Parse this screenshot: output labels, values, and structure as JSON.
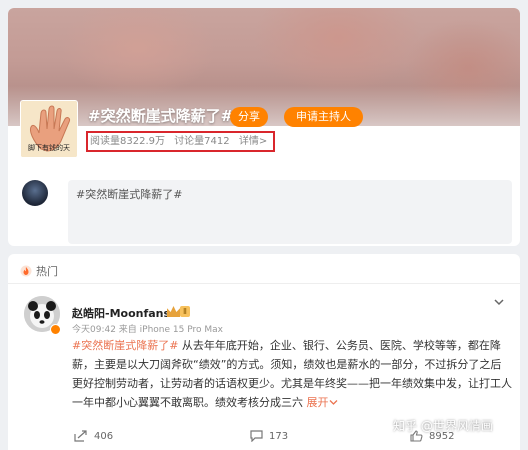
{
  "topic": {
    "title": "#突然断崖式降薪了#",
    "thumb_caption": "脚下有钱的天",
    "share_label": "分享",
    "host_label": "申请主持人",
    "read_count": "阅读量8322.9万",
    "discuss_count": "讨论量7412",
    "detail_link": "详情>"
  },
  "composer": {
    "text": "#突然断崖式降薪了#"
  },
  "hot": {
    "label": "热门"
  },
  "post": {
    "author": "赵皓阳-Moonfans",
    "level_badge": "Ⅱ",
    "meta": "今天09:42  来自 iPhone 15 Pro Max",
    "tag": "#突然断崖式降薪了#",
    "body": " 从去年年底开始，企业、银行、公务员、医院、学校等等，都在降薪，主要是以大刀阔斧砍“绩效”的方式。须知，绩效也是薪水的一部分，不过拆分了之后更好控制劳动者，让劳动者的话语权更少。尤其是年终奖——把一年绩效集中发，让打工人一年中都小心翼翼不敢离职。绩效考核分成三六",
    "expand": "展开",
    "reposts": "406",
    "comments": "173",
    "likes": "8952"
  },
  "watermark": "知乎 @世界风情画",
  "colors": {
    "accent": "#ff8200",
    "link": "#eb7350",
    "highlight_box": "#d9262c"
  }
}
